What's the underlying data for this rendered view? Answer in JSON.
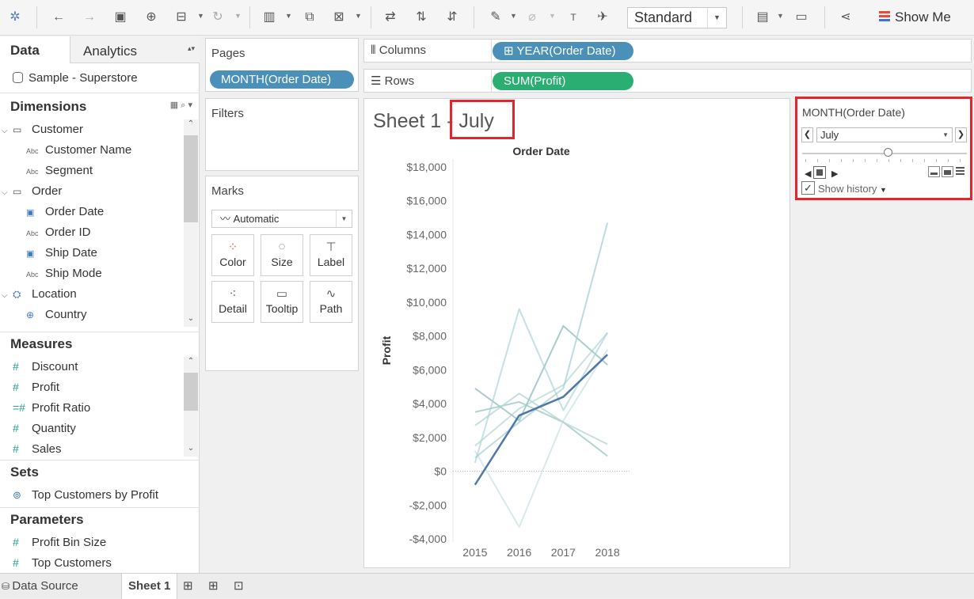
{
  "toolbar": {
    "standard_value": "Standard",
    "show_me_label": "Show Me"
  },
  "data_pane": {
    "tab_data": "Data",
    "tab_analytics": "Analytics",
    "source": "Sample - Superstore",
    "dimensions_title": "Dimensions",
    "dimensions": [
      {
        "label": "Customer",
        "kind": "folder"
      },
      {
        "label": "Customer Name",
        "kind": "abc"
      },
      {
        "label": "Segment",
        "kind": "abc"
      },
      {
        "label": "Order",
        "kind": "folder"
      },
      {
        "label": "Order Date",
        "kind": "date"
      },
      {
        "label": "Order ID",
        "kind": "abc"
      },
      {
        "label": "Ship Date",
        "kind": "date"
      },
      {
        "label": "Ship Mode",
        "kind": "abc"
      },
      {
        "label": "Location",
        "kind": "hierarchy"
      },
      {
        "label": "Country",
        "kind": "geo"
      }
    ],
    "measures_title": "Measures",
    "measures": [
      "Discount",
      "Profit",
      "Profit Ratio",
      "Quantity",
      "Sales"
    ],
    "sets_title": "Sets",
    "sets": [
      "Top Customers by Profit"
    ],
    "parameters_title": "Parameters",
    "parameters": [
      "Profit Bin Size",
      "Top Customers"
    ]
  },
  "abc_glyph": "Abc",
  "shelves": {
    "pages_title": "Pages",
    "pages_pill": "MONTH(Order Date)",
    "filters_title": "Filters",
    "marks_title": "Marks",
    "marks_type": "Automatic",
    "mark_buttons": [
      "Color",
      "Size",
      "Label",
      "Detail",
      "Tooltip",
      "Path"
    ],
    "columns_label": "Columns",
    "columns_pill": "YEAR(Order Date)",
    "rows_label": "Rows",
    "rows_pill": "SUM(Profit)"
  },
  "sheet": {
    "title_prefix": "Sheet 1 - ",
    "title_month": "July"
  },
  "chart_data": {
    "type": "line",
    "title": "Order Date",
    "ylabel": "Profit",
    "xlabel": "",
    "categories": [
      "2015",
      "2016",
      "2017",
      "2018"
    ],
    "ylim": [
      -4000,
      18000
    ],
    "yticks": [
      "$18,000",
      "$16,000",
      "$14,000",
      "$12,000",
      "$10,000",
      "$8,000",
      "$6,000",
      "$4,000",
      "$2,000",
      "$0",
      "-$2,000",
      "-$4,000"
    ],
    "ytick_values": [
      18000,
      16000,
      14000,
      12000,
      10000,
      8000,
      6000,
      4000,
      2000,
      0,
      -2000,
      -4000
    ],
    "series": [
      {
        "values": [
          -800,
          3300,
          4400,
          6900
        ],
        "color": "#4e79a7",
        "opacity": 1.0,
        "width": 2.5
      },
      {
        "values": [
          800,
          2900,
          4900,
          14700
        ],
        "color": "#a8cfd6",
        "opacity": 0.75,
        "width": 2
      },
      {
        "values": [
          500,
          9600,
          3600,
          8200
        ],
        "color": "#a8cfd6",
        "opacity": 0.65,
        "width": 2
      },
      {
        "values": [
          4900,
          3000,
          8600,
          6300
        ],
        "color": "#9ec8c6",
        "opacity": 0.9,
        "width": 2
      },
      {
        "values": [
          2700,
          4600,
          2900,
          1600
        ],
        "color": "#b6d7d7",
        "opacity": 0.8,
        "width": 2
      },
      {
        "values": [
          3500,
          4100,
          2900,
          900
        ],
        "color": "#a9cfcb",
        "opacity": 0.9,
        "width": 2
      },
      {
        "values": [
          1200,
          -3300,
          3000,
          7200
        ],
        "color": "#d4e8ea",
        "opacity": 0.9,
        "width": 2
      },
      {
        "values": [
          1500,
          3700,
          5100,
          8200
        ],
        "color": "#bcd9d8",
        "opacity": 0.8,
        "width": 2
      }
    ]
  },
  "page_control": {
    "title": "MONTH(Order Date)",
    "selected": "July",
    "position": 0.545,
    "show_history_label": "Show history",
    "show_history_checked": "✓"
  },
  "bottom_tabs": {
    "data_source": "Data Source",
    "sheet1": "Sheet 1"
  }
}
